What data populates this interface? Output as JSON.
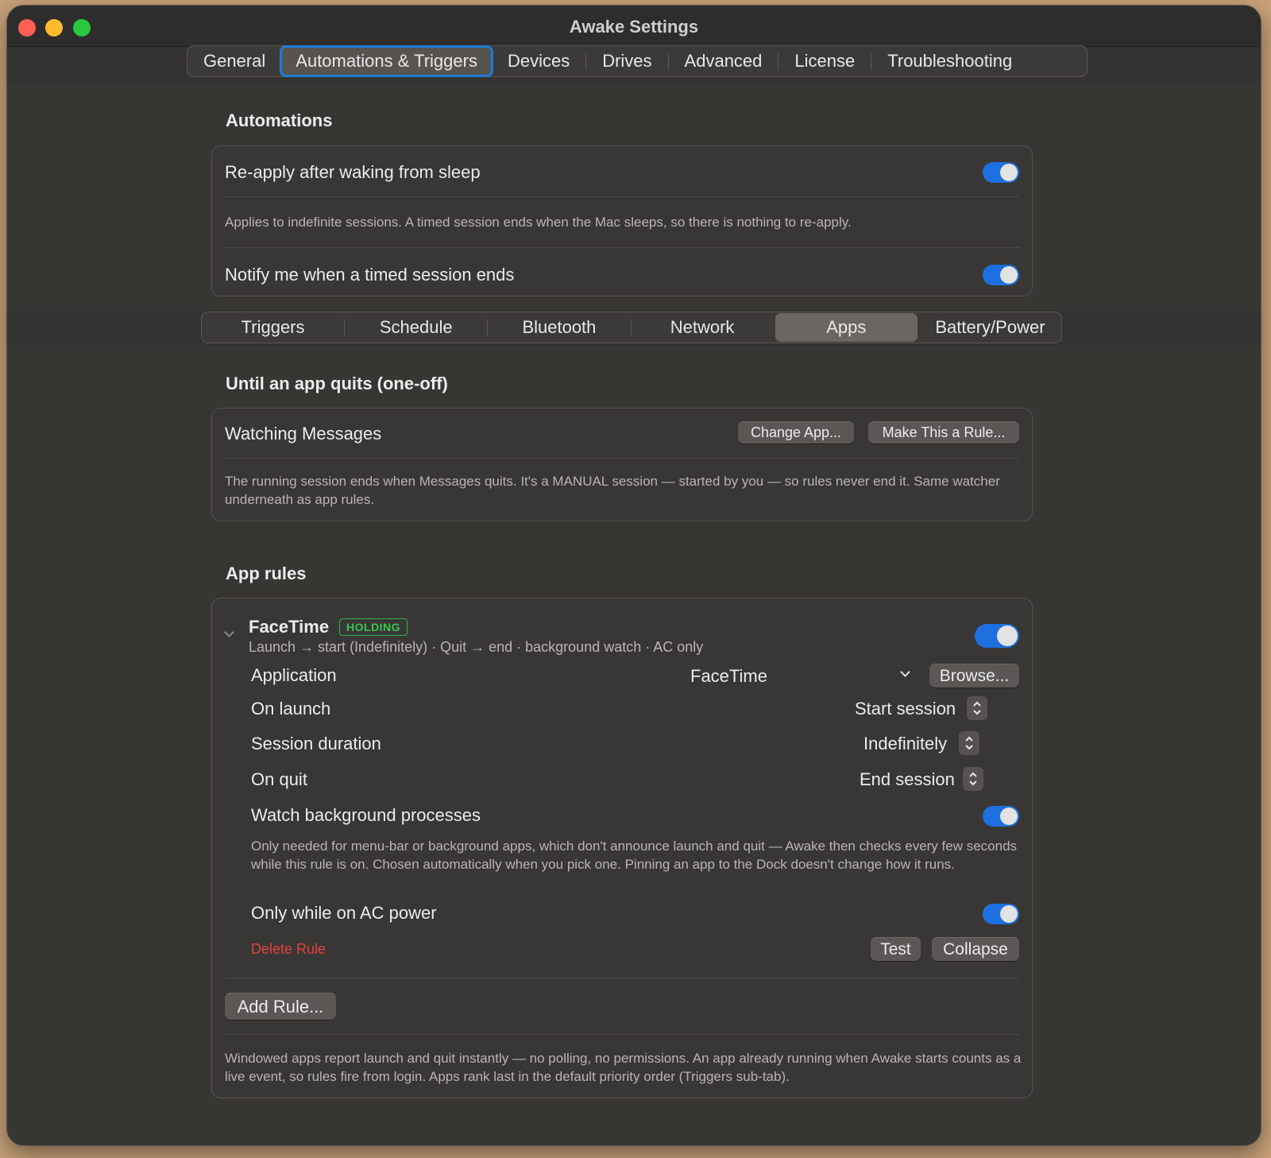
{
  "window": {
    "title": "Awake Settings"
  },
  "tabs": [
    "General",
    "Automations & Triggers",
    "Devices",
    "Drives",
    "Advanced",
    "License",
    "Troubleshooting"
  ],
  "active_tab": "Automations & Triggers",
  "automations": {
    "heading": "Automations",
    "reapply_label": "Re-apply after waking from sleep",
    "reapply_on": true,
    "reapply_note": "Applies to indefinite sessions. A timed session ends when the Mac sleeps, so there is nothing to re-apply.",
    "notify_label": "Notify me when a timed session ends",
    "notify_on": true
  },
  "subtabs": [
    "Triggers",
    "Schedule",
    "Bluetooth",
    "Network",
    "Apps",
    "Battery/Power"
  ],
  "active_subtab": "Apps",
  "one_off": {
    "heading": "Until an app quits (one-off)",
    "watching_label": "Watching Messages",
    "change_app_button": "Change App...",
    "make_rule_button": "Make This a Rule...",
    "note": "The running session ends when Messages quits. It's a MANUAL session — started by you — so rules never end it. Same watcher underneath as app rules."
  },
  "app_rules": {
    "heading": "App rules",
    "rule": {
      "name": "FaceTime",
      "badge": "HOLDING",
      "summary": "Launch → start (Indefinitely) · Quit → end · background watch · AC only",
      "enabled": true,
      "application_label": "Application",
      "application_value": "FaceTime",
      "browse_button": "Browse...",
      "on_launch_label": "On launch",
      "on_launch_value": "Start session",
      "duration_label": "Session duration",
      "duration_value": "Indefinitely",
      "on_quit_label": "On quit",
      "on_quit_value": "End session",
      "background_label": "Watch background processes",
      "background_on": true,
      "background_note": "Only needed for menu-bar or background apps, which don't announce launch and quit — Awake then checks every few seconds while this rule is on. Chosen automatically when you pick one. Pinning an app to the Dock doesn't change how it runs.",
      "ac_label": "Only while on AC power",
      "ac_on": true,
      "delete_label": "Delete Rule",
      "test_button": "Test",
      "collapse_button": "Collapse"
    },
    "add_rule_button": "Add Rule...",
    "footer_note": "Windowed apps report launch and quit instantly — no polling, no permissions. An app already running when Awake starts counts as a live event, so rules fire from login. Apps rank last in the default priority order (Triggers sub-tab)."
  },
  "colors": {
    "accent": "#1e6fe0",
    "holding_badge": "#37c653",
    "danger": "#e5413c"
  }
}
